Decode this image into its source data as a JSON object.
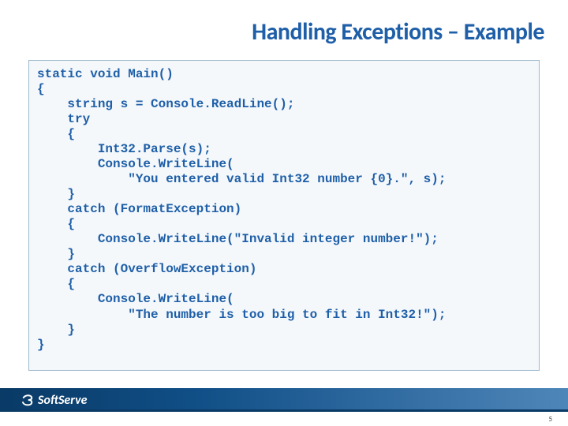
{
  "slide": {
    "title": "Handling Exceptions – Example",
    "code": "static void Main()\n{\n    string s = Console.ReadLine();\n    try\n    {\n        Int32.Parse(s);\n        Console.WriteLine(\n            \"You entered valid Int32 number {0}.\", s);\n    }\n    catch (FormatException)\n    {\n        Console.WriteLine(\"Invalid integer number!\");\n    }\n    catch (OverflowException)\n    {\n        Console.WriteLine(\n            \"The number is too big to fit in Int32!\");\n    }\n}"
  },
  "footer": {
    "brand": "SoftServe",
    "page": "5"
  }
}
